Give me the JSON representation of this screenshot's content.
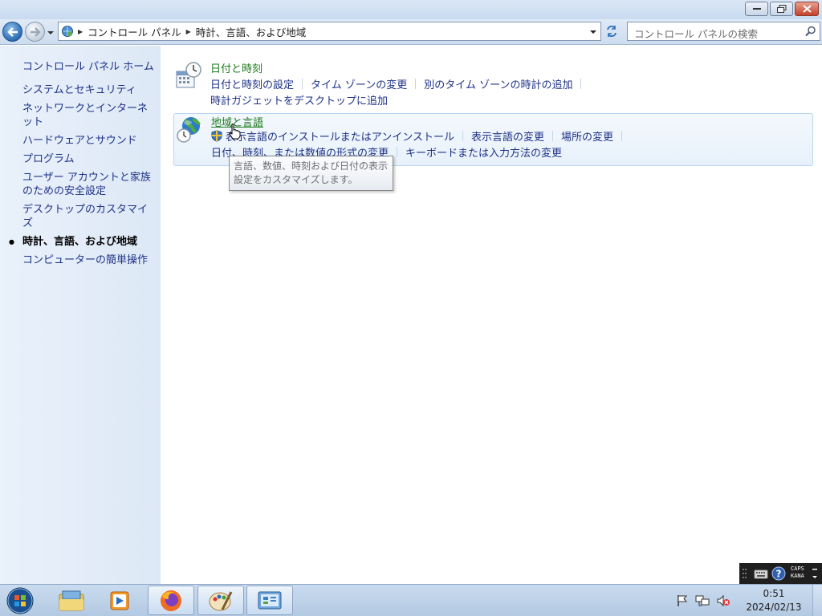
{
  "window": {
    "breadcrumb": [
      "コントロール パネル",
      "時計、言語、および地域"
    ],
    "search_placeholder": "コントロール パネルの検索"
  },
  "left_nav": {
    "home": "コントロール パネル ホーム",
    "items": [
      {
        "label": "システムとセキュリティ"
      },
      {
        "label": "ネットワークとインターネット"
      },
      {
        "label": "ハードウェアとサウンド"
      },
      {
        "label": "プログラム"
      },
      {
        "label": "ユーザー アカウントと家族のための安全設定"
      },
      {
        "label": "デスクトップのカスタマイズ"
      },
      {
        "label": "時計、言語、および地域",
        "current": true
      },
      {
        "label": "コンピューターの簡単操作"
      }
    ]
  },
  "categories": [
    {
      "title": "日付と時刻",
      "icon": "calendar-clock-icon",
      "row1": [
        "日付と時刻の設定",
        "タイム ゾーンの変更",
        "別のタイム ゾーンの時計の追加"
      ],
      "row2": [
        "時計ガジェットをデスクトップに追加"
      ]
    },
    {
      "title": "地域と言語",
      "icon": "globe-clock-icon",
      "row1": [
        "表示言語のインストールまたはアンインストール",
        "表示言語の変更",
        "場所の変更"
      ],
      "row2": [
        "日付、時刻、または数値の形式の変更",
        "キーボードまたは入力方法の変更"
      ]
    }
  ],
  "tooltip": {
    "line1": "言語、数値、時刻および日付の表示",
    "line2": "設定をカスタマイズします。"
  },
  "taskbar": {
    "pinned": [
      "start-orb-icon",
      "explorer-icon",
      "media-player-icon",
      "firefox-icon",
      "paint-icon",
      "control-panel-icon"
    ],
    "clock_time": "0:51",
    "clock_date": "2024/02/13"
  },
  "language_bar": {
    "caps": "CAPS",
    "kana": "KANA"
  }
}
